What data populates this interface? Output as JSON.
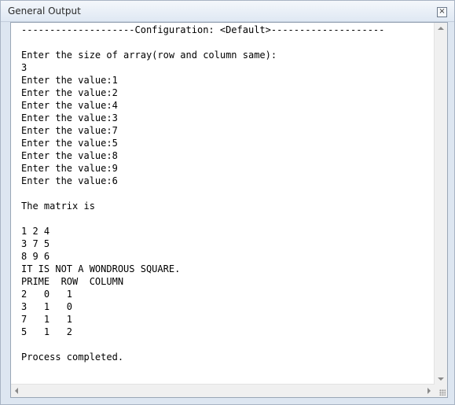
{
  "window": {
    "title": "General Output",
    "close_label": "×"
  },
  "console": {
    "lines": [
      "--------------------Configuration: <Default>--------------------",
      "",
      "Enter the size of array(row and column same):",
      "3",
      "Enter the value:1",
      "Enter the value:2",
      "Enter the value:4",
      "Enter the value:3",
      "Enter the value:7",
      "Enter the value:5",
      "Enter the value:8",
      "Enter the value:9",
      "Enter the value:6",
      "",
      "The matrix is",
      "",
      "1 2 4",
      "3 7 5",
      "8 9 6",
      "IT IS NOT A WONDROUS SQUARE.",
      "PRIME  ROW  COLUMN",
      "2   0   1",
      "3   1   0",
      "7   1   1",
      "5   1   2",
      "",
      "Process completed."
    ]
  }
}
